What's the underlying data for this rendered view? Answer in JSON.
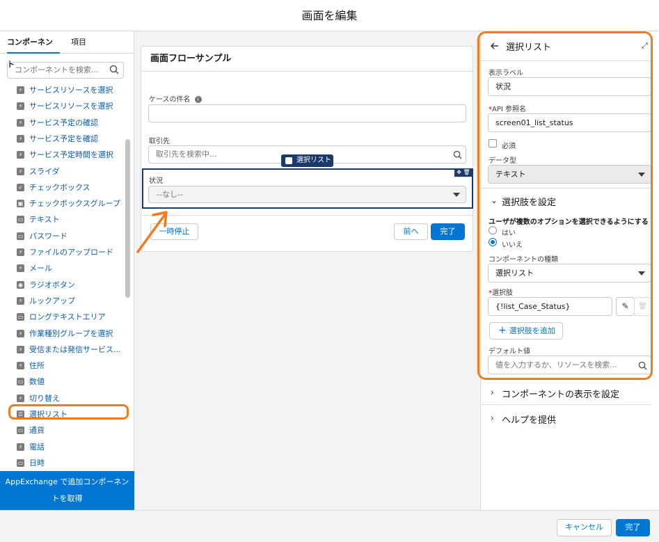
{
  "header": {
    "title": "画面を編集"
  },
  "left": {
    "tabs": [
      "コンポーネント",
      "項目"
    ],
    "search_placeholder": "コンポーネントを検索...",
    "items": [
      "サービスリソースを選択",
      "サービスリソースを選択",
      "サービス予定の確認",
      "サービス予定を確認",
      "サービス予定時間を選択",
      "スライダ",
      "チェックボックス",
      "チェックボックスグループ",
      "テキスト",
      "パスワード",
      "ファイルのアップロード",
      "メール",
      "ラジオボタン",
      "ルックアップ",
      "ロングテキストエリア",
      "作業種別グループを選択",
      "受信または発信サービス...",
      "住所",
      "数値",
      "切り替え",
      "選択リスト",
      "通貨",
      "電話",
      "日時"
    ],
    "appexchange_line1": "AppExchange で追加コンポーネン",
    "appexchange_line2": "トを取得"
  },
  "canvas": {
    "title": "画面フローサンプル",
    "field1_label": "ケースの件名",
    "field2_label": "取引先",
    "field2_placeholder": "取引先を検索中...",
    "badge_label": "選択リスト",
    "field3_label": "状況",
    "field3_value": "--なし--",
    "pause_button": "一時停止",
    "prev_button": "前へ",
    "finish_button": "完了"
  },
  "right": {
    "title": "選択リスト",
    "display_label_label": "表示ラベル",
    "display_label_value": "状況",
    "api_label": "API 参照名",
    "api_value": "screen01_list_status",
    "required_label": "必須",
    "datatype_label": "データ型",
    "datatype_value": "テキスト",
    "choices_section": "選択肢を設定",
    "multi_question": "ユーザが複数のオプションを選択できるようにする",
    "yes": "はい",
    "no": "いいえ",
    "component_type_label": "コンポーネントの種類",
    "component_type_value": "選択リスト",
    "choice_label": "選択肢",
    "choice_value": "{!list_Case_Status}",
    "add_choice_button": "選択肢を追加",
    "default_label": "デフォルト値",
    "default_placeholder": "値を入力するか、リソースを検索...",
    "visibility_section": "コンポーネントの表示を設定",
    "help_section": "ヘルプを提供"
  },
  "footer": {
    "cancel": "キャンセル",
    "done": "完了"
  },
  "colors": {
    "brand": "#0176d3",
    "highlight": "#f07c1e",
    "navy": "#1b3a6b"
  }
}
